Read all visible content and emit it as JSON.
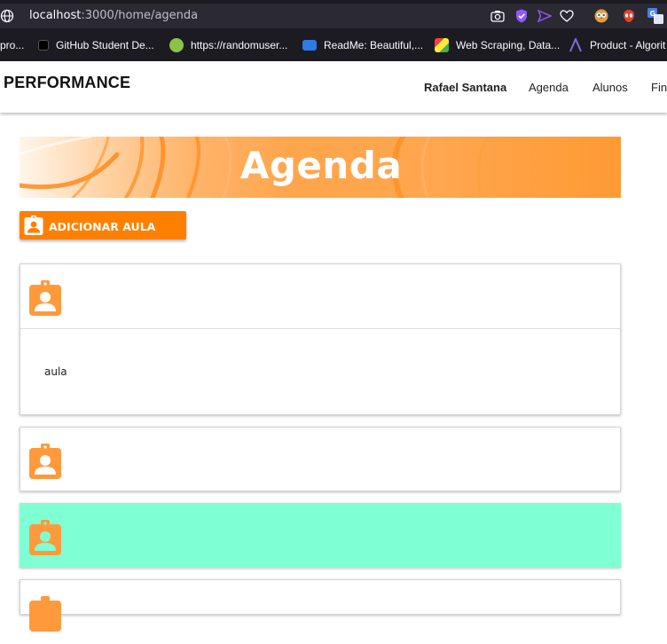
{
  "browser": {
    "url_host": "localhost",
    "url_path": ":3000/home/agenda",
    "bookmarks": [
      {
        "label": "pro..."
      },
      {
        "label": "GitHub Student De..."
      },
      {
        "label": "https://randomuser..."
      },
      {
        "label": "ReadMe: Beautiful,..."
      },
      {
        "label": "Web Scraping, Data..."
      },
      {
        "label": "Product - Algorit"
      }
    ],
    "icons": [
      "globe-icon",
      "camera-icon",
      "shield-icon",
      "send-icon",
      "heart-icon",
      "owl-icon",
      "alien-icon",
      "translate-icon"
    ]
  },
  "navbar": {
    "brand": "PERFORMANCE",
    "user": "Rafael Santana",
    "links": [
      "Agenda",
      "Alunos",
      "Fina"
    ]
  },
  "banner": {
    "title": "Agenda"
  },
  "actions": {
    "add_label": "ADICIONAR AULA"
  },
  "cards": [
    {
      "expanded": true,
      "body": "aula",
      "bg": "#ffffff"
    },
    {
      "expanded": false,
      "bg": "#ffffff"
    },
    {
      "expanded": false,
      "bg": "#7fffd4"
    },
    {
      "expanded": false,
      "bg": "#ffffff"
    }
  ],
  "colors": {
    "accent": "#ff7f00",
    "badge": "#ff9a3c",
    "highlight": "#7fffd4"
  }
}
